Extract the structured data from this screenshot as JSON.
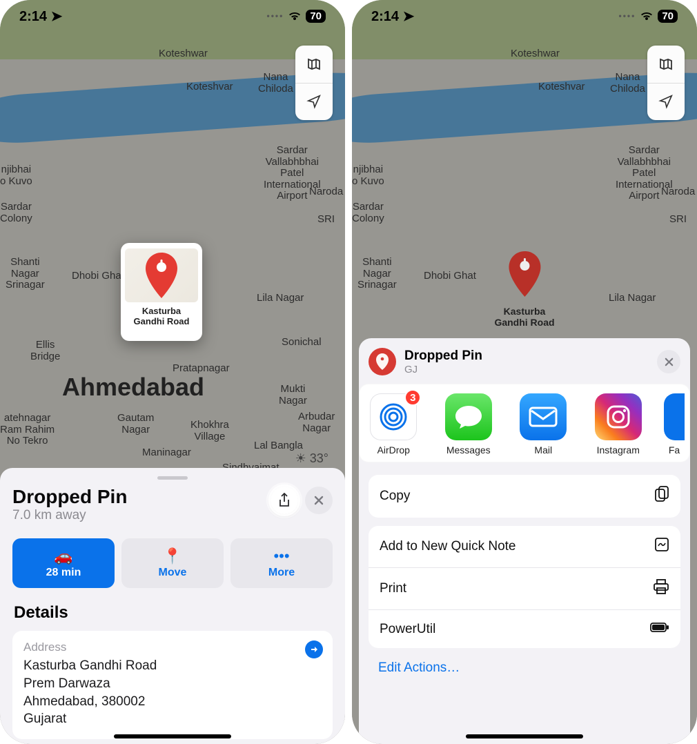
{
  "status": {
    "time": "2:14",
    "battery": "70",
    "loc_icon": "location-arrow"
  },
  "map": {
    "city_label": "Ahmedabad",
    "temperature": "33°",
    "labels": [
      "Koteshwar",
      "Koteshvar",
      "Nana\nChiloda",
      "Sardar\nVallabhbhai\nPatel\nInternational\nAirport",
      "Naroda",
      "Sardar\nColony",
      "SRI",
      "njibhai\no Kuvo",
      "Shanti\nNagar\nSrinagar",
      "Dhobi Ghat",
      "Lila Nagar",
      "Ellis\nBridge",
      "Sonichal",
      "Pratapnagar",
      "Mukti\nNagar",
      "Arbudar\nNagar",
      "atehnagar\nRam Rahim\nNo Tekro",
      "Gautam\nNagar",
      "Khokhra\nVillage",
      "Maninagar",
      "Lal Bangla",
      "Sindhvaimat"
    ]
  },
  "map_controls": {
    "mode_icon": "map-mode",
    "locate_icon": "locate"
  },
  "preview": {
    "pin_label": "Kasturba\nGandhi Road"
  },
  "sheet1": {
    "title": "Dropped Pin",
    "subtitle": "7.0 km away",
    "share_icon": "share",
    "close_icon": "close",
    "tiles": {
      "drive": {
        "eta": "28 min",
        "icon": "car"
      },
      "move": {
        "label": "Move",
        "icon": "pin-move"
      },
      "more": {
        "label": "More",
        "icon": "ellipsis"
      }
    },
    "details_heading": "Details",
    "address_label": "Address",
    "address_lines": [
      "Kasturba Gandhi Road",
      "Prem Darwaza",
      "Ahmedabad, 380002",
      "Gujarat"
    ],
    "go_icon": "turn-right"
  },
  "share": {
    "title": "Dropped Pin",
    "subtitle": "GJ",
    "close_icon": "close",
    "apps": [
      {
        "name": "AirDrop",
        "icon": "airdrop",
        "badge": "3",
        "bg": "#ffffff",
        "ring": "#0a72ea"
      },
      {
        "name": "Messages",
        "icon": "messages",
        "bg": "linear-gradient(180deg,#5ae35a,#1cc41c)"
      },
      {
        "name": "Mail",
        "icon": "mail",
        "bg": "linear-gradient(180deg,#34a7ff,#0a72ea)"
      },
      {
        "name": "Instagram",
        "icon": "instagram",
        "bg": "linear-gradient(45deg,#feda75,#fa7e1e,#d62976,#962fbf,#4f5bd5)"
      },
      {
        "name": "Facebook",
        "icon": "facebook",
        "bg": "#0a72ea"
      }
    ],
    "actions_group1": [
      {
        "label": "Copy",
        "icon": "copy-icon"
      }
    ],
    "actions_group2": [
      {
        "label": "Add to New Quick Note",
        "icon": "quicknote-icon"
      },
      {
        "label": "Print",
        "icon": "print-icon"
      },
      {
        "label": "PowerUtil",
        "icon": "battery-icon"
      }
    ],
    "edit_label": "Edit Actions…"
  }
}
